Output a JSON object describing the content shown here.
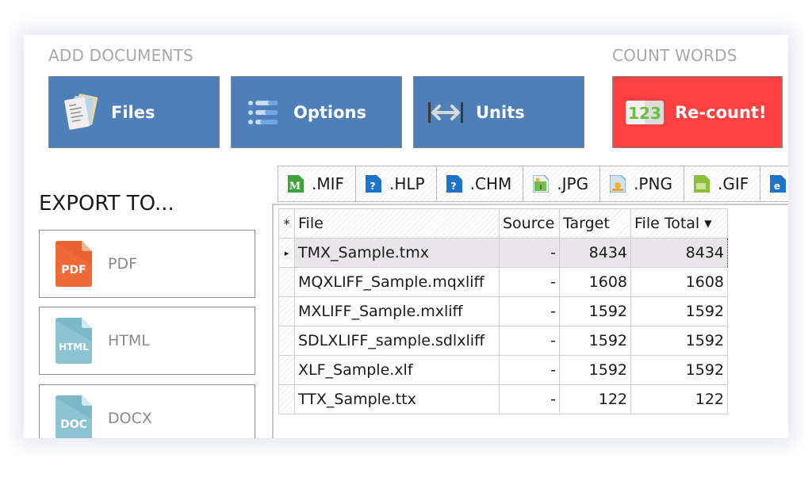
{
  "sections": {
    "add_documents": "ADD DOCUMENTS",
    "count_words": "COUNT WORDS",
    "export_to": "EXPORT TO..."
  },
  "toolbar": {
    "buttons": [
      {
        "label": "Files",
        "icon": "files-icon"
      },
      {
        "label": "Options",
        "icon": "options-list-icon"
      },
      {
        "label": "Units",
        "icon": "units-arrows-icon"
      },
      {
        "label": "Re-count!",
        "icon": "counter-123-icon"
      }
    ],
    "colors": {
      "primary": "#4e7fb8",
      "recount": "#ff4040"
    }
  },
  "export": {
    "items": [
      {
        "label": "PDF",
        "icon_text": "PDF",
        "color": "#ef6a36"
      },
      {
        "label": "HTML",
        "icon_text": "HTML",
        "color": "#8cc3d3"
      },
      {
        "label": "DOCX",
        "icon_text": "DOC",
        "color": "#8cc3d3"
      }
    ]
  },
  "format_tabs": [
    {
      "label": ".MIF",
      "icon": "mif-file-icon"
    },
    {
      "label": ".HLP",
      "icon": "help-file-icon"
    },
    {
      "label": ".CHM",
      "icon": "chm-file-icon"
    },
    {
      "label": ".JPG",
      "icon": "jpg-image-icon"
    },
    {
      "label": ".PNG",
      "icon": "png-image-icon"
    },
    {
      "label": ".GIF",
      "icon": "gif-image-icon"
    },
    {
      "label": "",
      "icon": "html-file-icon"
    }
  ],
  "grid": {
    "row_header_symbol": "*",
    "selected_indicator": "▸",
    "columns": [
      "File",
      "Source",
      "Target",
      "File Total"
    ],
    "sorted_column": "File Total",
    "rows": [
      {
        "file": "TMX_Sample.tmx",
        "source": "-",
        "target": "8434",
        "total": "8434",
        "selected": true
      },
      {
        "file": "MQXLIFF_Sample.mqxliff",
        "source": "-",
        "target": "1608",
        "total": "1608"
      },
      {
        "file": "MXLIFF_Sample.mxliff",
        "source": "-",
        "target": "1592",
        "total": "1592"
      },
      {
        "file": "SDLXLIFF_sample.sdlxliff",
        "source": "-",
        "target": "1592",
        "total": "1592"
      },
      {
        "file": "XLF_Sample.xlf",
        "source": "-",
        "target": "1592",
        "total": "1592"
      },
      {
        "file": "TTX_Sample.ttx",
        "source": "-",
        "target": "122",
        "total": "122"
      }
    ]
  }
}
